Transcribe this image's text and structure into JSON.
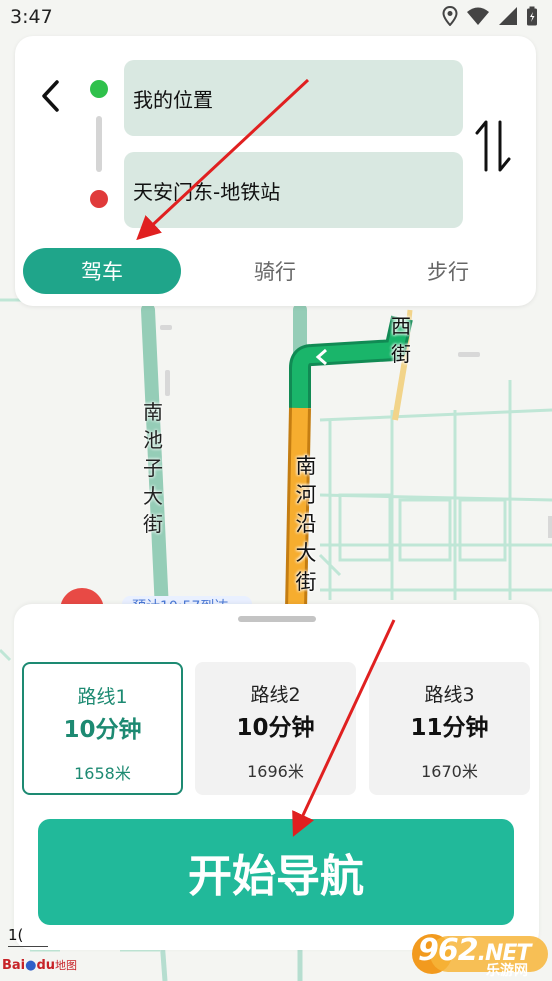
{
  "status_bar": {
    "time": "3:47",
    "icons": [
      "location-icon",
      "wifi-icon",
      "signal-icon",
      "battery-icon"
    ]
  },
  "route_panel": {
    "start_field": "我的位置",
    "end_field": "天安门东-地铁站",
    "modes": [
      {
        "label": "驾车",
        "active": true
      },
      {
        "label": "骑行",
        "active": false
      },
      {
        "label": "步行",
        "active": false
      }
    ]
  },
  "map": {
    "street_labels": [
      "南池子大街",
      "南河沿大街",
      "西街"
    ],
    "scale_label": "1(",
    "logo_text_bai": "Bai",
    "logo_text_du": "du",
    "logo_text_map": "地图"
  },
  "route_options": [
    {
      "name": "路线1",
      "time": "10分钟",
      "distance": "1658米",
      "selected": true
    },
    {
      "name": "路线2",
      "time": "10分钟",
      "distance": "1696米",
      "selected": false
    },
    {
      "name": "路线3",
      "time": "11分钟",
      "distance": "1670米",
      "selected": false
    }
  ],
  "start_button": "开始导航",
  "watermark": {
    "main": "962",
    "suffix": ".NET",
    "sub": "乐游网"
  },
  "colors": {
    "accent": "#21b99a",
    "accent_dark": "#1d8a72",
    "field_bg": "#d9e8e1",
    "start_dot": "#2fc14b",
    "end_dot": "#e03a3a",
    "route_green": "#16a06a",
    "route_orange": "#f2a52b",
    "annotation_arrow": "#e02020"
  }
}
